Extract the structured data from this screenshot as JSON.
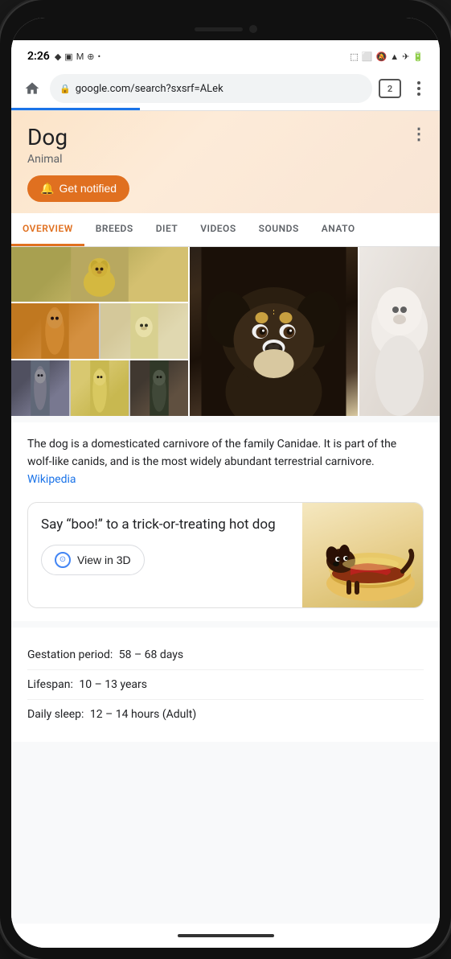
{
  "status_bar": {
    "time": "2:26",
    "tab_count": "2",
    "url": "google.com/search?sxsrf=ALek"
  },
  "entity": {
    "title": "Dog",
    "subtitle": "Animal",
    "notify_label": "Get notified",
    "more_label": "⋮"
  },
  "tabs": [
    {
      "label": "OVERVIEW",
      "active": true
    },
    {
      "label": "BREEDS",
      "active": false
    },
    {
      "label": "DIET",
      "active": false
    },
    {
      "label": "VIDEOS",
      "active": false
    },
    {
      "label": "SOUNDS",
      "active": false
    },
    {
      "label": "ANATO",
      "active": false
    }
  ],
  "description": {
    "text": "The dog is a domesticated carnivore of the family Canidae. It is part of the wolf-like canids, and is the most widely abundant terrestrial carnivore.",
    "wiki_label": "Wikipedia",
    "wiki_url": "#"
  },
  "fun_card": {
    "title": "Say “boo!” to a trick-or-treating hot dog",
    "view3d_label": "View in 3D"
  },
  "facts": [
    {
      "label": "Gestation period:",
      "value": "58 – 68 days"
    },
    {
      "label": "Lifespan:",
      "value": "10 – 13 years"
    },
    {
      "label": "Daily sleep:",
      "value": "12 – 14 hours (Adult)"
    }
  ],
  "colors": {
    "accent": "#e07020",
    "link": "#1a73e8"
  }
}
